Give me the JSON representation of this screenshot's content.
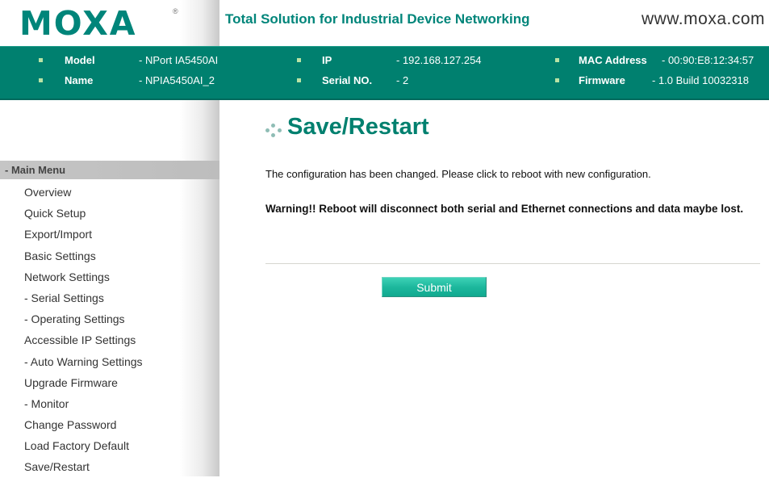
{
  "header": {
    "logo": "MOXA",
    "logo_mark": "®",
    "tagline": "Total Solution for Industrial Device Networking",
    "website": "www.moxa.com"
  },
  "device_info": {
    "model": {
      "label": "Model",
      "value": "- NPort IA5450AI"
    },
    "name": {
      "label": "Name",
      "value": "- NPIA5450AI_2"
    },
    "ip": {
      "label": "IP",
      "value": "- 192.168.127.254"
    },
    "serial_no": {
      "label": "Serial NO.",
      "value": "- 2"
    },
    "mac_address": {
      "label": "MAC Address",
      "value": "- 00:90:E8:12:34:57"
    },
    "firmware": {
      "label": "Firmware",
      "value": "- 1.0 Build 10032318"
    }
  },
  "sidebar": {
    "heading": "- Main Menu",
    "items": [
      "Overview",
      "Quick Setup",
      "Export/Import",
      "Basic Settings",
      "Network Settings",
      "- Serial Settings",
      "- Operating Settings",
      "Accessible IP Settings",
      "- Auto Warning Settings",
      "Upgrade Firmware",
      "- Monitor",
      "Change Password",
      "Load Factory Default",
      "Save/Restart"
    ]
  },
  "main": {
    "title": "Save/Restart",
    "message": "The configuration has been changed. Please click to reboot with new configuration.",
    "warning": "Warning!! Reboot will disconnect both serial and Ethernet connections and data maybe lost.",
    "submit_label": "Submit"
  },
  "colors": {
    "brand": "#00806f",
    "band": "#00806f",
    "bullet": "#b9e3a5",
    "button": "#1db89d"
  }
}
